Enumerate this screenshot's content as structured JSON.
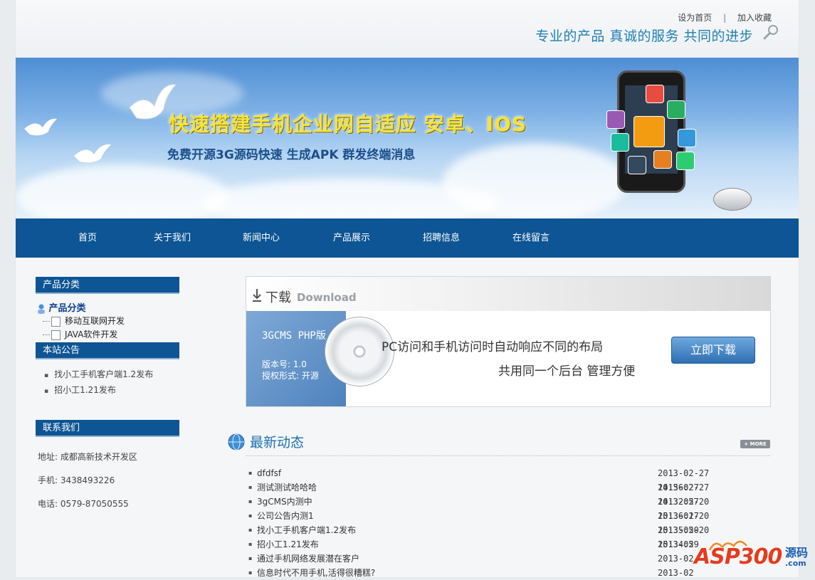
{
  "header": {
    "links": [
      "设为首页",
      "加入收藏"
    ],
    "separator": "|",
    "slogan": "专业的产品  真诚的服务 共同的进步"
  },
  "banner": {
    "title": "快速搭建手机企业网自适应 安卓、IOS",
    "subtitle": "免费开源3G源码快速 生成APK 群发终端消息"
  },
  "nav": {
    "items": [
      "首页",
      "关于我们",
      "新闻中心",
      "产品展示",
      "招聘信息",
      "在线留言"
    ]
  },
  "sidebar": {
    "category": {
      "title": "产品分类",
      "root": "产品分类",
      "items": [
        "移动互联网开发",
        "JAVA软件开发"
      ]
    },
    "notice": {
      "title": "本站公告",
      "items": [
        "找小工手机客户端1.2发布",
        "招小工1.21发布"
      ]
    },
    "contact": {
      "title": "联系我们",
      "address": "地址: 成都高新技术开发区",
      "mobile": "手机: 3438493226",
      "phone": "电话: 0579-87050555"
    }
  },
  "download": {
    "title": "下载",
    "title_en": "Download",
    "product": "3GCMS PHP版",
    "version": "版本号: 1.0",
    "license": "授权形式: 开源",
    "line1": "PC访问和手机访问时自动响应不同的布局",
    "line2": "共用同一个后台 管理方便",
    "button": "立即下载"
  },
  "news": {
    "title": "最新动态",
    "more": "+ MORE",
    "items": [
      {
        "title": "dfdfsf",
        "date": "2013-02-27 14:56:27"
      },
      {
        "title": "测试测试哈哈哈",
        "date": "2013-02-27 14:32:57"
      },
      {
        "title": "3gCMS内测中",
        "date": "2013-02-20 15:36:17"
      },
      {
        "title": "公司公告内测1",
        "date": "2013-02-20 15:35:50"
      },
      {
        "title": "找小工手机客户端1.2发布",
        "date": "2013-02-20 15:34:59"
      },
      {
        "title": "招小工1.21发布",
        "date": "2013-02"
      },
      {
        "title": "通过手机网络发展潜在客户",
        "date": "2013-02"
      },
      {
        "title": "信息时代不用手机,活得很糟糕?",
        "date": "2013-02"
      }
    ]
  },
  "watermark": {
    "brand": "ASP300",
    "cn": "源码",
    "suffix": ".com"
  }
}
